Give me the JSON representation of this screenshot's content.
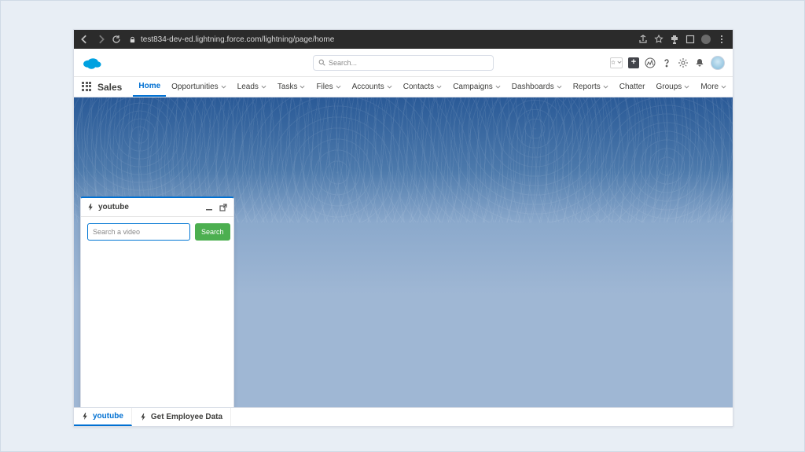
{
  "browser": {
    "url": "test834-dev-ed.lightning.force.com/lightning/page/home"
  },
  "header": {
    "search_placeholder": "Search..."
  },
  "nav": {
    "app_name": "Sales",
    "items": [
      {
        "label": "Home",
        "has_menu": false,
        "active": true
      },
      {
        "label": "Opportunities",
        "has_menu": true
      },
      {
        "label": "Leads",
        "has_menu": true
      },
      {
        "label": "Tasks",
        "has_menu": true
      },
      {
        "label": "Files",
        "has_menu": true
      },
      {
        "label": "Accounts",
        "has_menu": true
      },
      {
        "label": "Contacts",
        "has_menu": true
      },
      {
        "label": "Campaigns",
        "has_menu": true
      },
      {
        "label": "Dashboards",
        "has_menu": true
      },
      {
        "label": "Reports",
        "has_menu": true
      },
      {
        "label": "Chatter",
        "has_menu": false
      },
      {
        "label": "Groups",
        "has_menu": true
      },
      {
        "label": "More",
        "has_menu": true
      }
    ]
  },
  "panel": {
    "title": "youtube",
    "input_placeholder": "Search a video",
    "search_label": "Search"
  },
  "utility_bar": {
    "items": [
      {
        "label": "youtube",
        "active": true
      },
      {
        "label": "Get Employee Data",
        "active": false
      }
    ]
  }
}
